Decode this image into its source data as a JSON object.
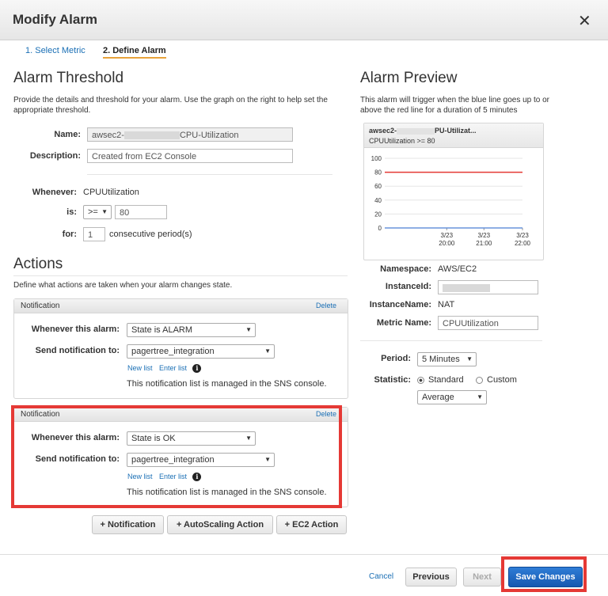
{
  "dialog": {
    "title": "Modify Alarm"
  },
  "steps": [
    {
      "label": "1. Select Metric"
    },
    {
      "label": "2. Define Alarm"
    }
  ],
  "threshold": {
    "heading": "Alarm Threshold",
    "description": "Provide the details and threshold for your alarm. Use the graph on the right to help set the appropriate threshold.",
    "name_label": "Name:",
    "name_value_prefix": "awsec2-",
    "name_value_suffix": "CPU-Utilization",
    "description_label": "Description:",
    "description_value": "Created from EC2 Console",
    "whenever_label": "Whenever:",
    "whenever_value": "CPUUtilization",
    "is_label": "is:",
    "operator": ">=",
    "threshold_value": "80",
    "for_label": "for:",
    "periods_value": "1",
    "periods_suffix": "consecutive period(s)"
  },
  "actions": {
    "heading": "Actions",
    "description": "Define what actions are taken when your alarm changes state.",
    "notifications": [
      {
        "header": "Notification",
        "delete": "Delete",
        "whenever_label": "Whenever this alarm:",
        "state": "State is ALARM",
        "send_label": "Send notification to:",
        "topic": "pagertree_integration",
        "new_list": "New list",
        "enter_list": "Enter list",
        "managed_text": "This notification list is managed in the SNS console."
      },
      {
        "header": "Notification",
        "delete": "Delete",
        "whenever_label": "Whenever this alarm:",
        "state": "State is OK",
        "send_label": "Send notification to:",
        "topic": "pagertree_integration",
        "new_list": "New list",
        "enter_list": "Enter list",
        "managed_text": "This notification list is managed in the SNS console."
      }
    ],
    "buttons": {
      "notification": "+ Notification",
      "autoscaling": "+ AutoScaling Action",
      "ec2": "+ EC2 Action"
    }
  },
  "preview": {
    "heading": "Alarm Preview",
    "description": "This alarm will trigger when the blue line goes up to or above the red line for a duration of 5 minutes",
    "chart_title_prefix": "awsec2-",
    "chart_title_suffix": "PU-Utilizat...",
    "chart_subtitle": "CPUUtilization >= 80",
    "namespace_label": "Namespace:",
    "namespace_value": "AWS/EC2",
    "instanceid_label": "InstanceId:",
    "instanceid_value": "",
    "instancename_label": "InstanceName:",
    "instancename_value": "NAT",
    "metricname_label": "Metric Name:",
    "metricname_value": "CPUUtilization",
    "period_label": "Period:",
    "period_value": "5 Minutes",
    "statistic_label": "Statistic:",
    "statistic_standard": "Standard",
    "statistic_custom": "Custom",
    "statistic_value": "Average"
  },
  "chart_data": {
    "type": "line",
    "title": "",
    "xlabel": "",
    "ylabel": "",
    "ylim": [
      0,
      100
    ],
    "y_ticks": [
      "100",
      "80",
      "60",
      "40",
      "20",
      "0"
    ],
    "x_ticks": [
      {
        "date": "3/23",
        "time": "20:00"
      },
      {
        "date": "3/23",
        "time": "21:00"
      },
      {
        "date": "3/23",
        "time": "22:00"
      }
    ],
    "series": [
      {
        "color": "#4a7fd4",
        "values": [
          0,
          0,
          0,
          0
        ]
      },
      {
        "color": "#e53935",
        "values": [
          80,
          80,
          80,
          80
        ]
      }
    ],
    "grid": true,
    "legend": "none"
  },
  "footer": {
    "cancel": "Cancel",
    "previous": "Previous",
    "next": "Next",
    "save": "Save Changes"
  },
  "colors": {
    "accent": "#1a6fb5",
    "highlight": "#e53935",
    "save_button": "#1565c0",
    "step_underline": "#e8a33b"
  }
}
